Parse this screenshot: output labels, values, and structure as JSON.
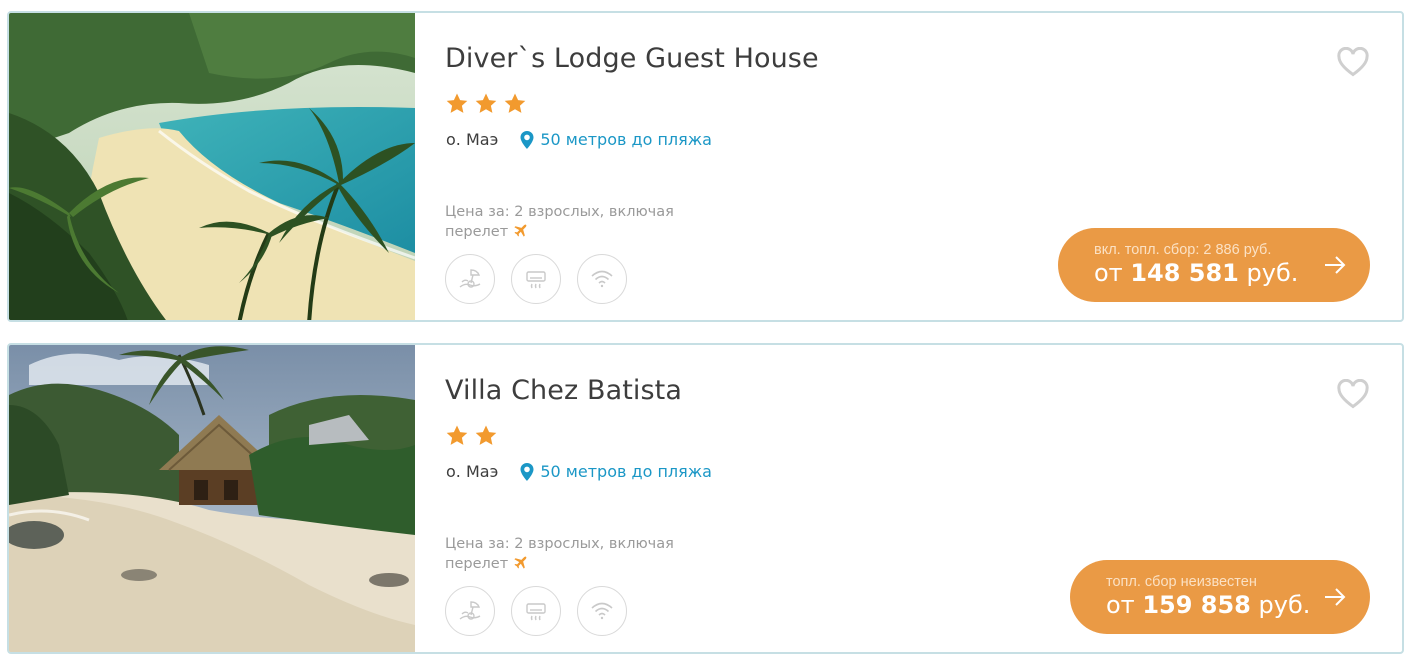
{
  "hotels": [
    {
      "name": "Diver`s Lodge Guest House",
      "stars": 3,
      "island": "о. Маэ",
      "beach_distance": "50 метров до пляжа",
      "price_note": "Цена за: 2 взрослых, включая перелет",
      "fee_text": "вкл. топл. сбор: 2 886 руб.",
      "price_prefix": "от",
      "price_value": "148 581",
      "price_suffix": "руб.",
      "amenities": [
        "beach-umbrella-icon",
        "air-conditioner-icon",
        "wifi-icon"
      ]
    },
    {
      "name": "Villa Chez Batista",
      "stars": 2,
      "island": "о. Маэ",
      "beach_distance": "50 метров до пляжа",
      "price_note": "Цена за: 2 взрослых, включая перелет",
      "fee_text": "топл. сбор неизвестен",
      "price_prefix": "от",
      "price_value": "159 858",
      "price_suffix": "руб.",
      "amenities": [
        "beach-umbrella-icon",
        "air-conditioner-icon",
        "wifi-icon"
      ]
    }
  ],
  "colors": {
    "accent": "#ea9a45",
    "link": "#1b97c6",
    "star": "#f29a2e",
    "border": "#c6dfe4",
    "title": "#3d3d3d"
  }
}
